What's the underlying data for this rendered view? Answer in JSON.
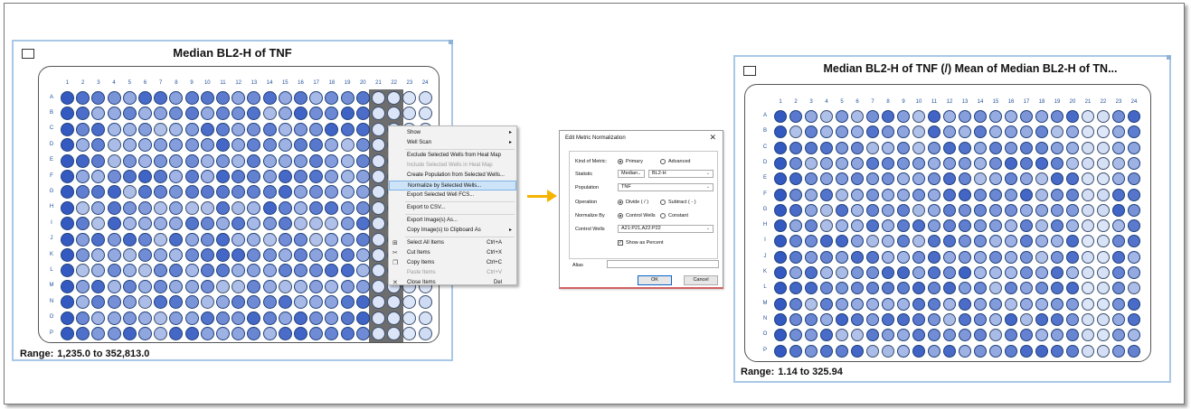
{
  "left_panel": {
    "title": "Median BL2-H of TNF",
    "range_label": "Range:",
    "range_value": "1,235.0 to 352,813.0",
    "min": 1235,
    "max": 352813,
    "selected_columns": [
      21,
      22
    ]
  },
  "right_panel": {
    "title": "Median BL2-H of TNF (/) Mean of Median BL2-H of TN...",
    "range_label": "Range:",
    "range_value": "1.14 to 325.94",
    "min": 1.14,
    "max": 325.94
  },
  "plate": {
    "columns": [
      "1",
      "2",
      "3",
      "4",
      "5",
      "6",
      "7",
      "8",
      "9",
      "10",
      "11",
      "12",
      "13",
      "14",
      "15",
      "16",
      "17",
      "18",
      "19",
      "20",
      "21",
      "22",
      "23",
      "24"
    ],
    "rows": [
      "A",
      "B",
      "C",
      "D",
      "E",
      "F",
      "G",
      "H",
      "I",
      "J",
      "K",
      "L",
      "M",
      "N",
      "O",
      "P"
    ]
  },
  "context_menu": {
    "items": [
      {
        "label": "Show",
        "submenu": true
      },
      {
        "label": "Well Scan",
        "submenu": true
      },
      {
        "separator": true
      },
      {
        "label": "Exclude Selected Wells from Heat Map"
      },
      {
        "label": "Include Selected Wells in Heat Map",
        "disabled": true
      },
      {
        "label": "Create Population from Selected Wells..."
      },
      {
        "label": "Normalize by Selected Wells...",
        "hover": true
      },
      {
        "label": "Export Selected Well FCS..."
      },
      {
        "separator": true
      },
      {
        "label": "Export to CSV..."
      },
      {
        "separator": true
      },
      {
        "label": "Export Image(s) As..."
      },
      {
        "label": "Copy Image(s) to Clipboard As",
        "submenu": true
      },
      {
        "separator": true
      },
      {
        "label": "Select All Items",
        "shortcut": "Ctrl+A",
        "icon": "select-all-icon",
        "glyph": "⊞"
      },
      {
        "label": "Cut Items",
        "shortcut": "Ctrl+X",
        "icon": "scissors-icon",
        "glyph": "✂"
      },
      {
        "label": "Copy Items",
        "shortcut": "Ctrl+C",
        "icon": "copy-icon",
        "glyph": "❐"
      },
      {
        "label": "Paste Items",
        "shortcut": "Ctrl+V",
        "disabled": true
      },
      {
        "label": "Close Items",
        "shortcut": "Del",
        "icon": "close-icon",
        "glyph": "✕"
      }
    ]
  },
  "dialog": {
    "title": "Edit Metric Normalization",
    "close_glyph": "✕",
    "kind_label": "Kind of Metric:",
    "kind_primary": "Primary",
    "kind_advanced": "Advanced",
    "statistic_label": "Statistic",
    "statistic_value": "Median",
    "channel_value": "BL2-H",
    "population_label": "Population",
    "population_value": "TNF",
    "operation_label": "Operation",
    "op_divide": "Divide ( / )",
    "op_subtract": "Subtract ( - )",
    "normalize_label": "Normalize By",
    "norm_control": "Control Wells",
    "norm_constant": "Constant",
    "control_wells_label": "Control Wells",
    "control_wells_value": "A21:P21,A22:P22",
    "show_percent_label": "Show as Percent",
    "show_percent_checked": true,
    "alias_label": "Alias",
    "alias_value": "",
    "ok_label": "OK",
    "cancel_label": "Cancel"
  },
  "colors": {
    "accent_arrow": "#f5b400",
    "selection_hover": "#cde3f7",
    "heat_low": "#e6eefb",
    "heat_high": "#1540b8"
  }
}
